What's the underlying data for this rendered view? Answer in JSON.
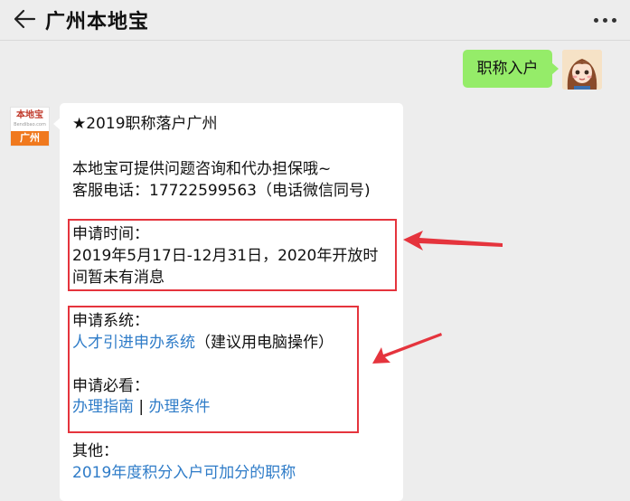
{
  "header": {
    "title": "广州本地宝"
  },
  "outgoing": {
    "text": "职称入户"
  },
  "bot_avatar": {
    "brand": "本地宝",
    "site": "Bendibao.com",
    "city": "广州"
  },
  "message": {
    "heading": "★2019职称落户广州",
    "intro_line1": "本地宝可提供问题咨询和代办担保哦~",
    "intro_line2": "客服电话：17722599563（电话微信同号)",
    "time_label": "申请时间：",
    "time_line1": "2019年5月17日-12月31日，2020年开放时",
    "time_line2": "间暂未有消息",
    "system_label": "申请系统：",
    "system_link": "人才引进申办系统",
    "system_note": "（建议用电脑操作）",
    "must_label": "申请必看：",
    "guide_link": "办理指南",
    "separator": " | ",
    "condition_link": "办理条件",
    "other_label": "其他：",
    "other_link": "2019年度积分入户可加分的职称"
  },
  "colors": {
    "bubble_out": "#95ec69",
    "link": "#2f7cc8",
    "highlight": "#e5343d"
  }
}
